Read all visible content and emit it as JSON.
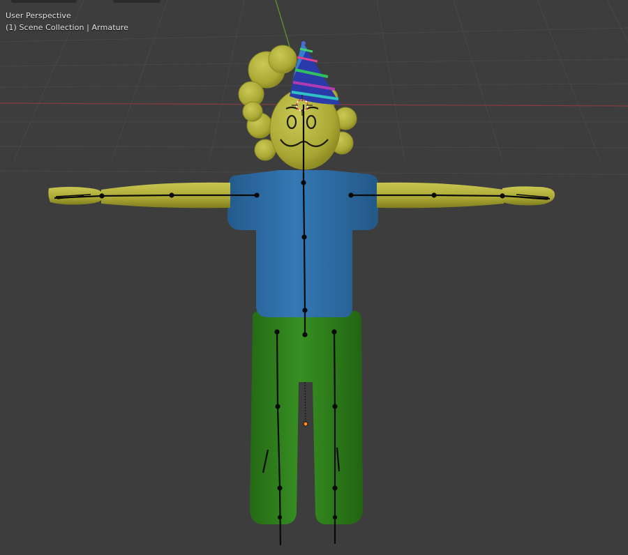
{
  "viewport": {
    "view_name": "User Perspective",
    "scene_path": "(1) Scene Collection | Armature"
  },
  "colors": {
    "background": "#3d3d3d",
    "grid": "#4a4a4a",
    "x_axis": "#8b3a3e",
    "y_axis": "#6a9a2a",
    "skin": "#b5b33a",
    "shirt": "#2f6fa8",
    "pants": "#2f7f1c",
    "bone": "#0a0a0a",
    "origin": "#ff8c1a"
  },
  "objects": {
    "character": "character-mesh",
    "armature": "armature",
    "hat": "party-hat",
    "cursor": "3d-cursor-icon"
  }
}
